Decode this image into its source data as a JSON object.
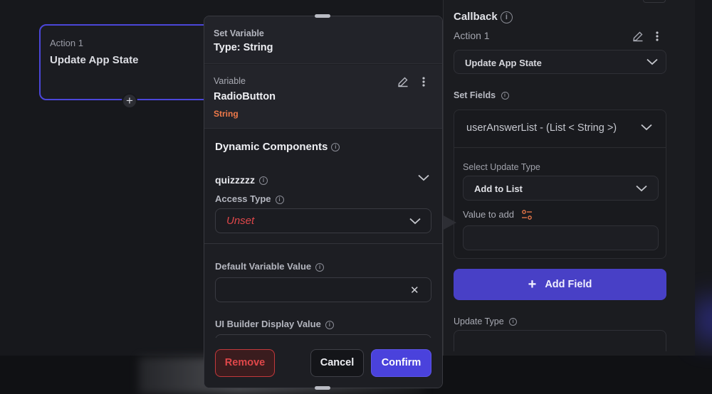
{
  "action_card": {
    "number": "Action 1",
    "title": "Update App State"
  },
  "modal": {
    "header_title": "Set Variable",
    "header_type": "Type: String",
    "variable_label": "Variable",
    "variable_name": "RadioButton",
    "variable_type": "String",
    "dynamic_components_title": "Dynamic Components",
    "component_name": "quizzzzz",
    "access_type_label": "Access Type",
    "access_type_value": "Unset",
    "default_value_label": "Default Variable Value",
    "default_value_input": "",
    "ui_builder_label": "UI Builder Display Value",
    "remove_label": "Remove",
    "cancel_label": "Cancel",
    "confirm_label": "Confirm"
  },
  "right_panel": {
    "callback_title": "Callback",
    "action_label": "Action 1",
    "action_select": "Update App State",
    "set_fields_label": "Set Fields",
    "field_name": "userAnswerList - (List < String >)",
    "select_update_type_label": "Select Update Type",
    "update_type_value": "Add to List",
    "value_to_add_label": "Value to add",
    "add_field_label": "Add Field",
    "update_type_label": "Update Type"
  },
  "colors": {
    "accent": "#4a42dc",
    "danger": "#e0474a",
    "type_orange": "#f07a4a",
    "background": "#17181c"
  },
  "icons": [
    "info-icon",
    "edit-icon",
    "more-vertical-icon",
    "chevron-down-icon",
    "close-icon",
    "plus-icon",
    "variable-settings-icon",
    "drag-handle-icon"
  ]
}
